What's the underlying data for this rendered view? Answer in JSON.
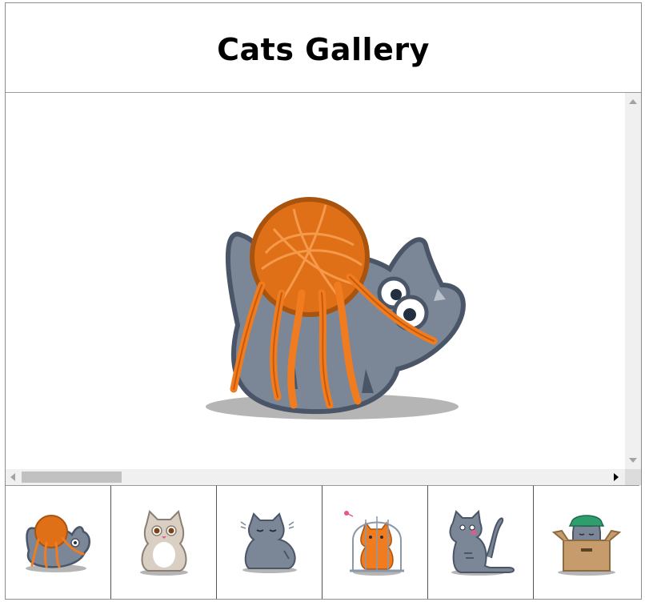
{
  "header": {
    "title": "Cats Gallery"
  },
  "viewer": {
    "main_image": "cat-with-yarn-ball",
    "scrollbar_vertical": "vertical-scrollbar",
    "scrollbar_horizontal": "horizontal-scrollbar"
  },
  "thumbnails": [
    {
      "name": "cat-with-yarn-ball",
      "icon": "yarn-cat-icon"
    },
    {
      "name": "cream-cat-sitting",
      "icon": "cream-cat-icon"
    },
    {
      "name": "gray-cat-sleepy",
      "icon": "sleepy-cat-icon"
    },
    {
      "name": "orange-cat-in-cage",
      "icon": "caged-cat-icon"
    },
    {
      "name": "gray-cat-with-mouse",
      "icon": "mouse-cat-icon"
    },
    {
      "name": "cat-in-box-with-hat",
      "icon": "box-cat-icon"
    }
  ],
  "colors": {
    "cat_gray": "#7b8797",
    "cat_outline": "#4a5668",
    "yarn_orange": "#f07c1f",
    "yarn_dark": "#c85a0a",
    "shadow": "#b5b5b5",
    "box_brown": "#c69c6d"
  }
}
